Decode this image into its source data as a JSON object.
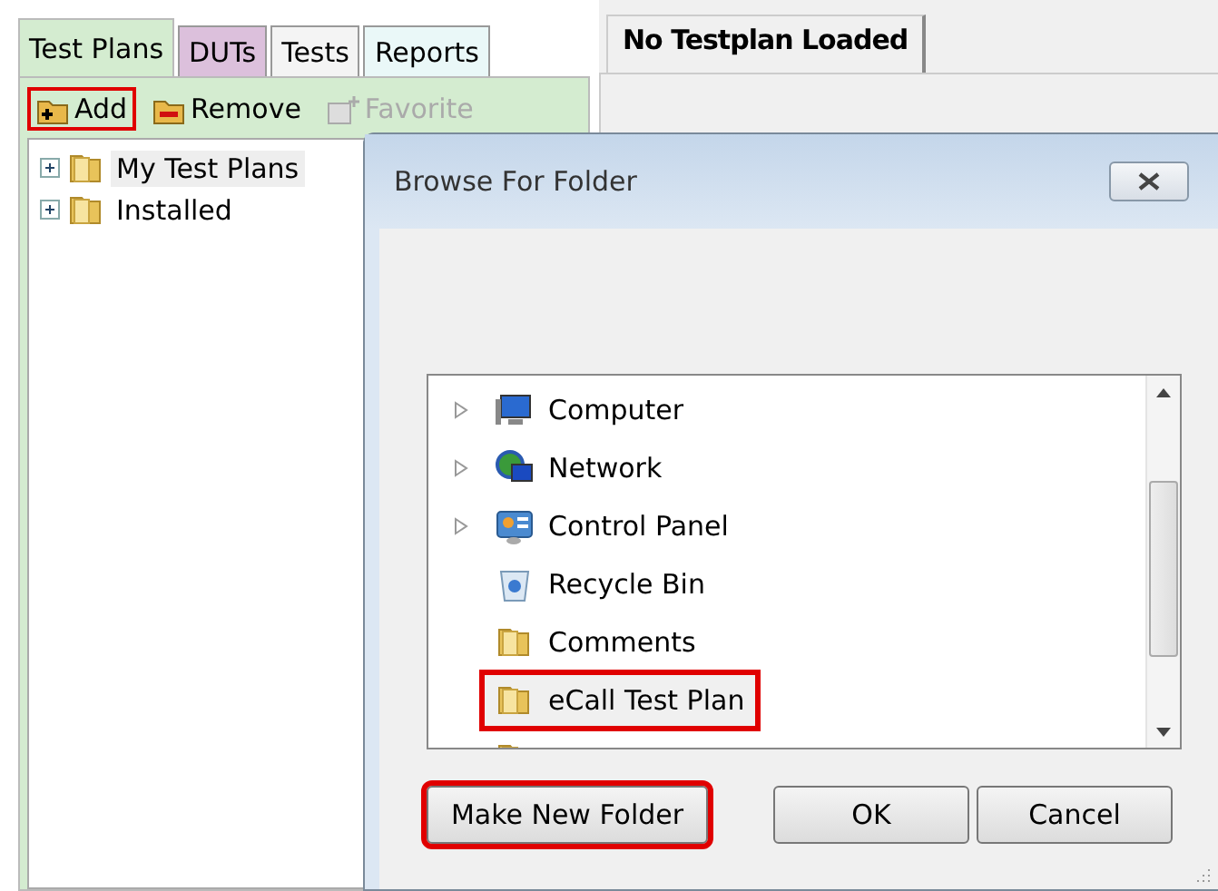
{
  "left_tabs": [
    {
      "label": "Test Plans",
      "selected": true,
      "color": "#d4ecd0"
    },
    {
      "label": "DUTs",
      "selected": false,
      "color": "#dcc0dc"
    },
    {
      "label": "Tests",
      "selected": false,
      "color": "#f4f4f4"
    },
    {
      "label": "Reports",
      "selected": false,
      "color": "#eaf8f8"
    }
  ],
  "toolbar": [
    {
      "label": "Add",
      "kind": "add",
      "disabled": false,
      "highlighted": true
    },
    {
      "label": "Remove",
      "kind": "remove",
      "disabled": false,
      "highlighted": false
    },
    {
      "label": "Favorite",
      "kind": "favorite",
      "disabled": true,
      "highlighted": false
    }
  ],
  "tree": [
    {
      "label": "My Test Plans",
      "selected": true,
      "expanded": false
    },
    {
      "label": "Installed",
      "selected": false,
      "expanded": false
    }
  ],
  "right_tabs": [
    {
      "label": "No Testplan Loaded"
    }
  ],
  "dialog": {
    "title": "Browse For Folder",
    "items": [
      {
        "label": "Computer",
        "kind": "computer",
        "expandable": true,
        "highlighted": false
      },
      {
        "label": "Network",
        "kind": "network",
        "expandable": true,
        "highlighted": false
      },
      {
        "label": "Control Panel",
        "kind": "control-panel",
        "expandable": true,
        "highlighted": false
      },
      {
        "label": "Recycle Bin",
        "kind": "recycle-bin",
        "expandable": false,
        "highlighted": false
      },
      {
        "label": "Comments",
        "kind": "folder",
        "expandable": false,
        "highlighted": false
      },
      {
        "label": "eCall Test Plan",
        "kind": "folder",
        "expandable": false,
        "highlighted": true
      },
      {
        "kind": "folder",
        "highlighted": false
      }
    ],
    "buttons": [
      {
        "label": "Make New Folder",
        "highlighted": true
      },
      {
        "label": "OK",
        "highlighted": false
      },
      {
        "label": "Cancel",
        "highlighted": false
      }
    ]
  }
}
